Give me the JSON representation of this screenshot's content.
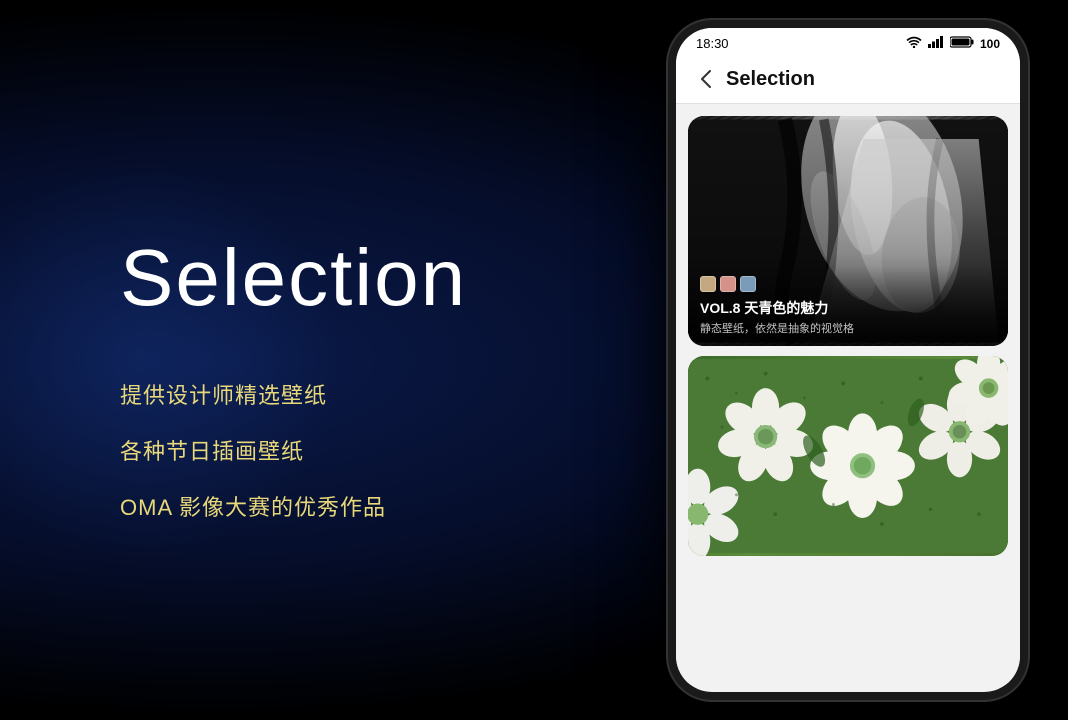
{
  "page": {
    "title": "Selection",
    "background": {
      "gradient_color_1": "#0a1a4a",
      "gradient_color_2": "#050d2a",
      "gradient_color_3": "#000000"
    }
  },
  "left": {
    "main_title": "Selection",
    "features": [
      "提供设计师精选壁纸",
      "各种节日插画壁纸",
      "OMA 影像大赛的优秀作品"
    ]
  },
  "phone": {
    "status_bar": {
      "time": "18:30",
      "wifi": "wifi",
      "signal": "signal",
      "battery": "100"
    },
    "nav": {
      "back_label": "‹",
      "title": "Selection"
    },
    "cards": [
      {
        "id": "card-1",
        "vol": "VOL.8 天青色的魅力",
        "subtitle": "静态壁纸，依然是抽象的视觉格",
        "colors": [
          "#c4a882",
          "#d4928a",
          "#7a9cb8"
        ]
      },
      {
        "id": "card-2",
        "theme": "floral-green"
      }
    ]
  }
}
